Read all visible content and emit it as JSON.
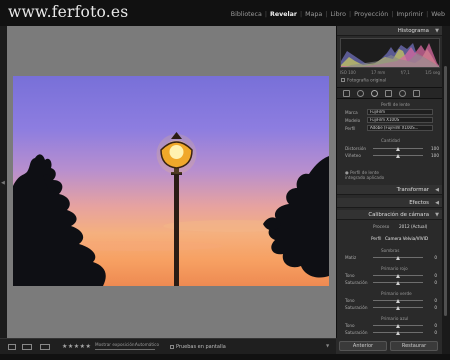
{
  "app": {
    "watermark": "www.ferfoto.es"
  },
  "modules": [
    {
      "label": "Biblioteca",
      "active": false
    },
    {
      "label": "Revelar",
      "active": true
    },
    {
      "label": "Mapa",
      "active": false
    },
    {
      "label": "Libro",
      "active": false
    },
    {
      "label": "Proyección",
      "active": false
    },
    {
      "label": "Imprimir",
      "active": false
    },
    {
      "label": "Web",
      "active": false
    }
  ],
  "histogram": {
    "title": "Histograma",
    "readout": {
      "iso": "ISO 100",
      "focal": "17 mm",
      "aperture": "f/7,1",
      "shutter": "1/5 seg"
    },
    "original_photo_label": "Fotografía original"
  },
  "camera_profile": {
    "section_label": "Perfil de lente",
    "rows": [
      {
        "label": "Marca",
        "value": "FujiFilm"
      },
      {
        "label": "Modelo",
        "value": "FujiFilm X100S"
      },
      {
        "label": "Perfil",
        "value": "Adobe (FujiFilm X100S..."
      }
    ]
  },
  "amount": {
    "label": "Cantidad",
    "rows": [
      {
        "label": "Distorsión",
        "value": "100",
        "fraction": 0.5
      },
      {
        "label": "Viñeteo",
        "value": "100",
        "fraction": 0.5
      }
    ]
  },
  "lens_note": "Perfil de lente integrado aplicado",
  "panels": {
    "transform": "Transformar",
    "effects": "Efectos",
    "calibration": "Calibración de cámara"
  },
  "calibration": {
    "process_label": "Proceso",
    "process_value": "2012 (Actual)",
    "profile_label": "Perfil",
    "profile_value": "Camera Velvia/VIVID",
    "groups": [
      {
        "title": "Sombras",
        "rows": [
          {
            "label": "Matiz",
            "value": "0",
            "fraction": 0.5
          }
        ]
      },
      {
        "title": "Primario rojo",
        "rows": [
          {
            "label": "Tono",
            "value": "0",
            "fraction": 0.5
          },
          {
            "label": "Saturación",
            "value": "0",
            "fraction": 0.5
          }
        ]
      },
      {
        "title": "Primario verde",
        "rows": [
          {
            "label": "Tono",
            "value": "0",
            "fraction": 0.5
          },
          {
            "label": "Saturación",
            "value": "0",
            "fraction": 0.5
          }
        ]
      },
      {
        "title": "Primario azul",
        "rows": [
          {
            "label": "Tono",
            "value": "0",
            "fraction": 0.5
          },
          {
            "label": "Saturación",
            "value": "0",
            "fraction": 0.5
          }
        ]
      }
    ]
  },
  "buttons": {
    "previous": "Anterior",
    "reset": "Restaurar"
  },
  "toolbar": {
    "rating": "★★★★★",
    "process_text": "Mostrar exposición: ",
    "auto_label": "Automático",
    "soft_proof": "Pruebas en pantalla"
  },
  "colors": {
    "panel": "#2a2a2a",
    "canvas": "#7b7b7b",
    "topbar": "#111111"
  }
}
